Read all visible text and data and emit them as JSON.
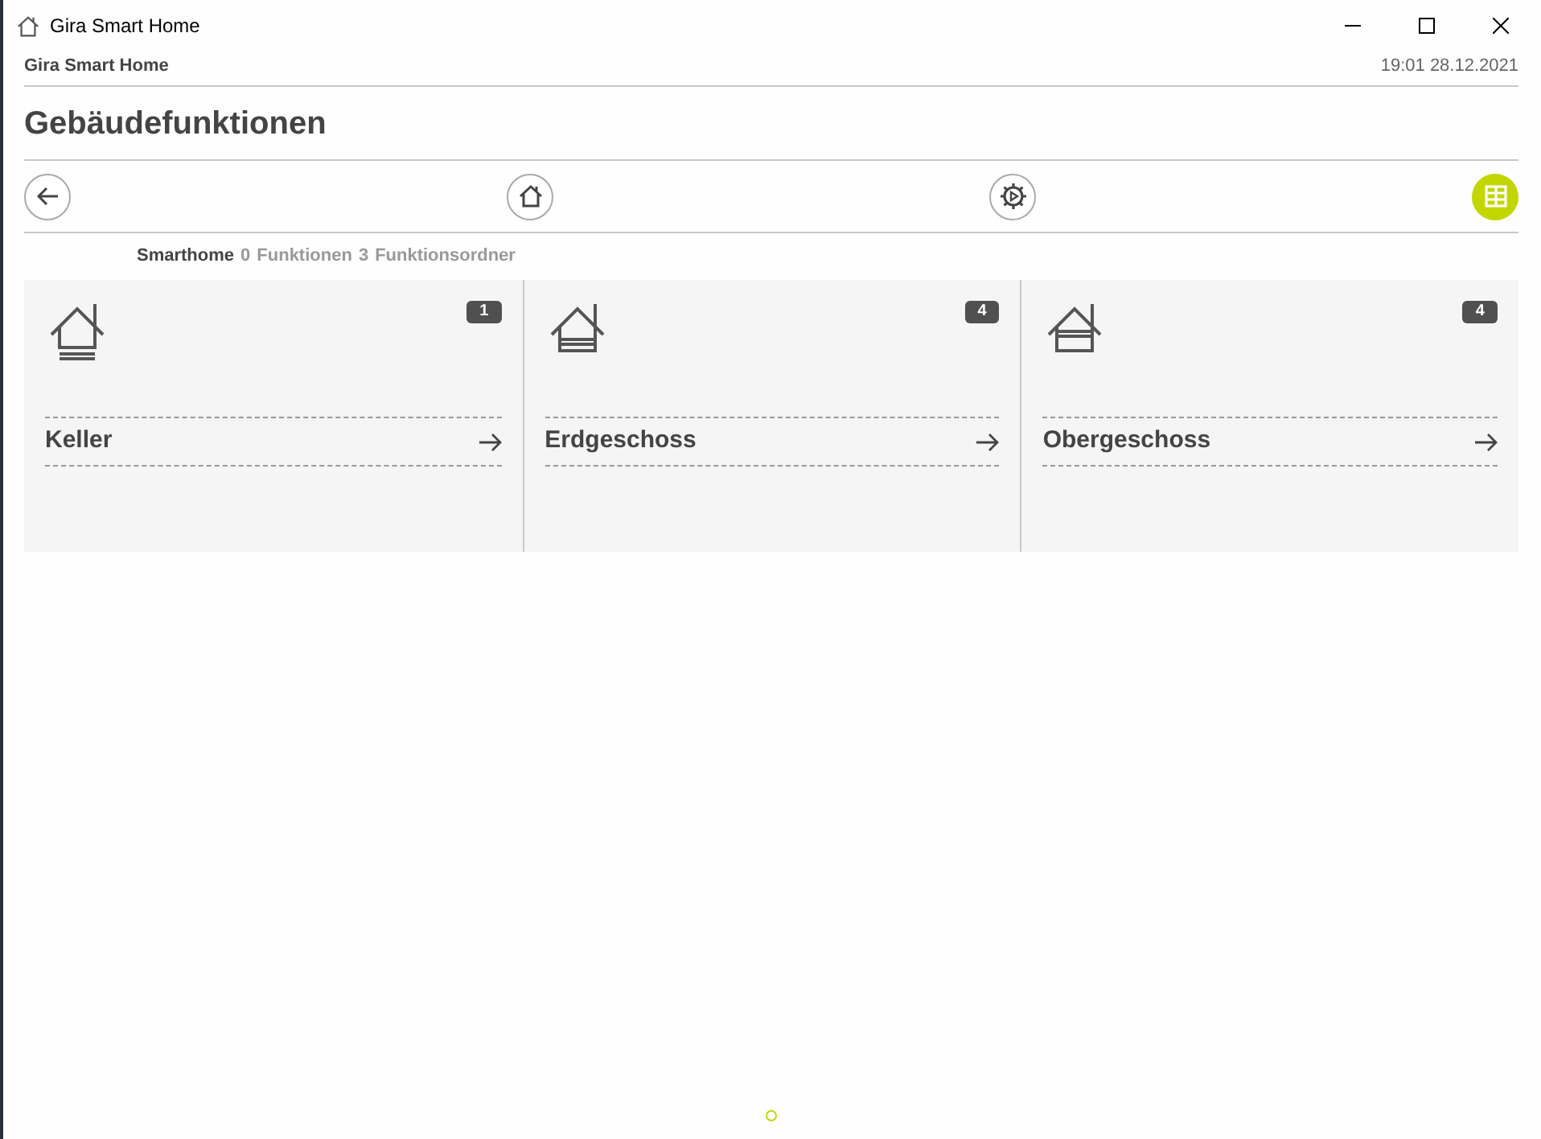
{
  "window": {
    "title": "Gira Smart Home"
  },
  "header": {
    "app_name": "Gira Smart Home",
    "datetime": "19:01 28.12.2021"
  },
  "page_title": "Gebäudefunktionen",
  "toolbar": [
    {
      "kind": "back",
      "selected": false
    },
    {
      "kind": "home",
      "selected": false
    },
    {
      "kind": "scenes",
      "selected": false
    },
    {
      "kind": "grid",
      "selected": true
    }
  ],
  "breadcrumb": {
    "location": "Smarthome",
    "functions_count": "0",
    "functions_label": "Funktionen",
    "folders_count": "3",
    "folders_label": "Funktionsordner"
  },
  "tiles": [
    {
      "kind": "basement",
      "badge": "1",
      "label": "Keller"
    },
    {
      "kind": "ground",
      "badge": "4",
      "label": "Erdgeschoss"
    },
    {
      "kind": "upper",
      "badge": "4",
      "label": "Obergeschoss"
    }
  ],
  "pager": [
    {
      "selected": true
    }
  ]
}
